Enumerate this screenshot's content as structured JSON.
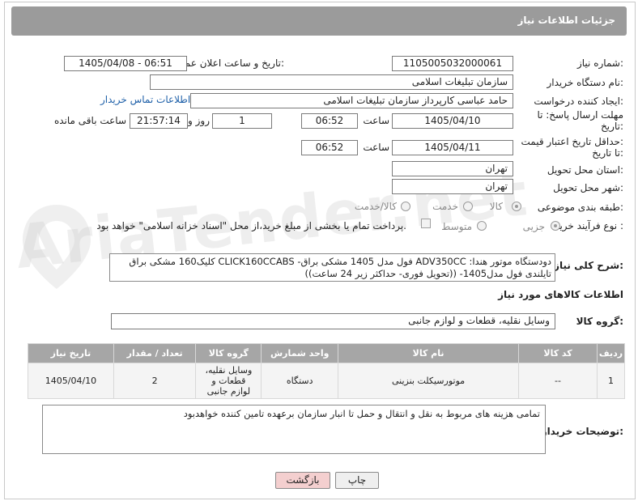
{
  "header": {
    "title": "جزئیات اطلاعات نیاز"
  },
  "fields": {
    "need_number_label": "شماره نیاز:",
    "need_number": "1105005032000061",
    "announce_label": "تاریخ و ساعت اعلان عمومی:",
    "announce_value": "1405/04/08 - 06:51",
    "buyer_org_label": "نام دستگاه خریدار:",
    "buyer_org": "سازمان تبلیغات اسلامی",
    "requester_label": "ایجاد کننده درخواست:",
    "requester": "حامد عباسی کارپرداز سازمان تبلیغات اسلامی",
    "contact_link": "اطلاعات تماس خریدار",
    "deadline_label_1": "مهلت ارسال پاسخ: تا",
    "deadline_label_2": "تاریخ:",
    "deadline_date": "1405/04/10",
    "time_label": "ساعت",
    "deadline_time": "06:52",
    "days_value": "1",
    "days_label": "روز و",
    "remaining_time": "21:57:14",
    "remaining_label": "ساعت باقی مانده",
    "validity_label_1": "حداقل تاریخ اعتبار قیمت:",
    "validity_label_2": "تا تاریخ:",
    "validity_date": "1405/04/11",
    "validity_time": "06:52",
    "province_label": "استان محل تحویل:",
    "province": "تهران",
    "city_label": "شهر محل تحویل:",
    "city": "تهران",
    "category_label": "طبقه بندی موضوعی:",
    "category_goods": "کالا",
    "category_service": "خدمت",
    "category_both": "کالا/خدمت",
    "process_label": "نوع فرآیند خرید :",
    "process_partial": "جزیی",
    "process_medium": "متوسط",
    "payment_note": "پرداخت تمام یا بخشی از مبلغ خرید،از محل \"اسناد خزانه اسلامی\" خواهد بود."
  },
  "description": {
    "label": "شرح کلی نیاز:",
    "text_line1": "دودستگاه موتور هندا: ADV350CC فول مدل 1405 مشکی براق- CLICK160CCABS کلیک160 مشکی براق",
    "text_line2": "تایلندی فول مدل1405- ((تحویل فوری- حداکثر زیر 24 ساعت))"
  },
  "goods_section": {
    "title": "اطلاعات کالاهای مورد نیاز",
    "group_label": "گروه کالا:",
    "group_value": "وسایل نقلیه، قطعات و لوازم جانبی"
  },
  "table": {
    "headers": [
      "ردیف",
      "کد کالا",
      "نام کالا",
      "واحد شمارش",
      "گروه کالا",
      "تعداد / مقدار",
      "تاریخ نیاز"
    ],
    "rows": [
      [
        "1",
        "--",
        "موتورسیکلت بنزینی",
        "دستگاه",
        "وسایل نقلیه، قطعات و لوازم جانبی",
        "2",
        "1405/04/10"
      ]
    ]
  },
  "buyer_notes": {
    "label": "توضیحات خریدار:",
    "text": "تمامی هزینه های مربوط به نقل و انتقال و حمل تا انبار سازمان برعهده تامین کننده خواهدبود"
  },
  "buttons": {
    "print": "چاپ",
    "back": "بازگشت"
  },
  "watermark": {
    "text": "AriaTender.net"
  }
}
